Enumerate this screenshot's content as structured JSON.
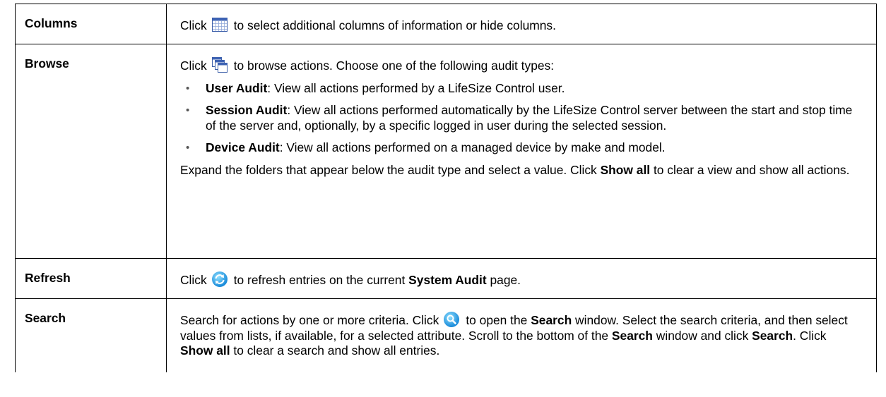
{
  "rows": [
    {
      "term": "Columns",
      "click": "Click",
      "icon": "columns-grid-icon",
      "after_icon": "to select additional columns of information or hide columns."
    },
    {
      "term": "Browse",
      "click": "Click",
      "icon": "browse-windows-icon",
      "after_icon": "to browse actions. Choose one of the following audit types:",
      "bullets": [
        {
          "bold": "User Audit",
          "text": ": View all actions performed by a LifeSize Control user."
        },
        {
          "bold": "Session Audit",
          "text": ": View all actions performed automatically by the LifeSize Control server between the start and stop time of the server and, optionally, by a specific logged in user during the selected session."
        },
        {
          "bold": "Device Audit",
          "text": ": View all actions performed on a managed device by make and model."
        }
      ],
      "footer_a": "Expand the folders that appear below the audit type and select a value. Click",
      "footer_bold": "Show all",
      "footer_b": "to clear a view and show all actions."
    },
    {
      "term": "Refresh",
      "click": "Click",
      "icon": "refresh-icon",
      "after_icon": "to refresh entries on the current",
      "bold": "System Audit",
      "tail": "page."
    },
    {
      "term": "Search",
      "pre": "Search for actions by one or more criteria. Click",
      "icon": "search-magnifier-icon",
      "mid1": "to open the",
      "bold1": "Search",
      "mid2": "window. Select the search criteria, and then select values from lists, if available, for a selected attribute. Scroll to the bottom of the",
      "bold2": "Search",
      "mid3": "window and click",
      "bold3": "Search",
      "mid4": ". Click",
      "bold4": "Show all",
      "tail": "to clear a search and show all entries."
    }
  ]
}
